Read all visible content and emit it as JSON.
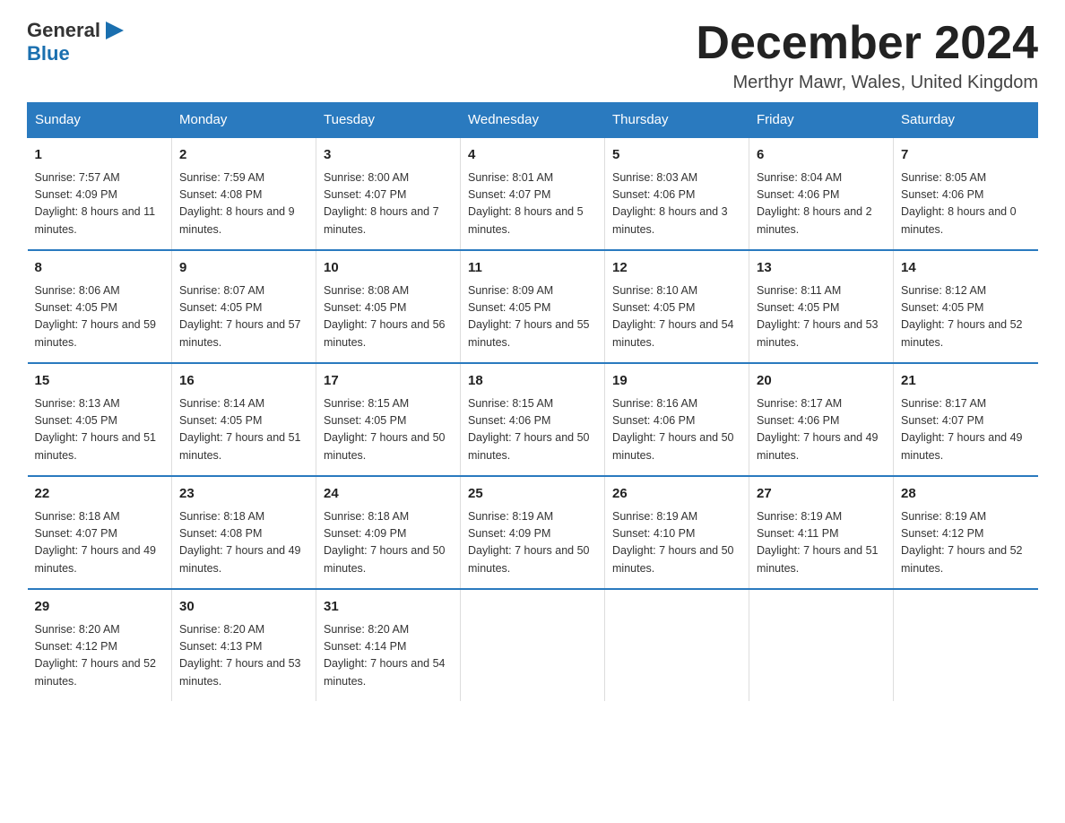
{
  "header": {
    "logo_text_black": "General",
    "logo_text_blue": "Blue",
    "month_title": "December 2024",
    "location": "Merthyr Mawr, Wales, United Kingdom"
  },
  "days_of_week": [
    "Sunday",
    "Monday",
    "Tuesday",
    "Wednesday",
    "Thursday",
    "Friday",
    "Saturday"
  ],
  "weeks": [
    [
      {
        "day": "1",
        "sunrise": "7:57 AM",
        "sunset": "4:09 PM",
        "daylight": "8 hours and 11 minutes."
      },
      {
        "day": "2",
        "sunrise": "7:59 AM",
        "sunset": "4:08 PM",
        "daylight": "8 hours and 9 minutes."
      },
      {
        "day": "3",
        "sunrise": "8:00 AM",
        "sunset": "4:07 PM",
        "daylight": "8 hours and 7 minutes."
      },
      {
        "day": "4",
        "sunrise": "8:01 AM",
        "sunset": "4:07 PM",
        "daylight": "8 hours and 5 minutes."
      },
      {
        "day": "5",
        "sunrise": "8:03 AM",
        "sunset": "4:06 PM",
        "daylight": "8 hours and 3 minutes."
      },
      {
        "day": "6",
        "sunrise": "8:04 AM",
        "sunset": "4:06 PM",
        "daylight": "8 hours and 2 minutes."
      },
      {
        "day": "7",
        "sunrise": "8:05 AM",
        "sunset": "4:06 PM",
        "daylight": "8 hours and 0 minutes."
      }
    ],
    [
      {
        "day": "8",
        "sunrise": "8:06 AM",
        "sunset": "4:05 PM",
        "daylight": "7 hours and 59 minutes."
      },
      {
        "day": "9",
        "sunrise": "8:07 AM",
        "sunset": "4:05 PM",
        "daylight": "7 hours and 57 minutes."
      },
      {
        "day": "10",
        "sunrise": "8:08 AM",
        "sunset": "4:05 PM",
        "daylight": "7 hours and 56 minutes."
      },
      {
        "day": "11",
        "sunrise": "8:09 AM",
        "sunset": "4:05 PM",
        "daylight": "7 hours and 55 minutes."
      },
      {
        "day": "12",
        "sunrise": "8:10 AM",
        "sunset": "4:05 PM",
        "daylight": "7 hours and 54 minutes."
      },
      {
        "day": "13",
        "sunrise": "8:11 AM",
        "sunset": "4:05 PM",
        "daylight": "7 hours and 53 minutes."
      },
      {
        "day": "14",
        "sunrise": "8:12 AM",
        "sunset": "4:05 PM",
        "daylight": "7 hours and 52 minutes."
      }
    ],
    [
      {
        "day": "15",
        "sunrise": "8:13 AM",
        "sunset": "4:05 PM",
        "daylight": "7 hours and 51 minutes."
      },
      {
        "day": "16",
        "sunrise": "8:14 AM",
        "sunset": "4:05 PM",
        "daylight": "7 hours and 51 minutes."
      },
      {
        "day": "17",
        "sunrise": "8:15 AM",
        "sunset": "4:05 PM",
        "daylight": "7 hours and 50 minutes."
      },
      {
        "day": "18",
        "sunrise": "8:15 AM",
        "sunset": "4:06 PM",
        "daylight": "7 hours and 50 minutes."
      },
      {
        "day": "19",
        "sunrise": "8:16 AM",
        "sunset": "4:06 PM",
        "daylight": "7 hours and 50 minutes."
      },
      {
        "day": "20",
        "sunrise": "8:17 AM",
        "sunset": "4:06 PM",
        "daylight": "7 hours and 49 minutes."
      },
      {
        "day": "21",
        "sunrise": "8:17 AM",
        "sunset": "4:07 PM",
        "daylight": "7 hours and 49 minutes."
      }
    ],
    [
      {
        "day": "22",
        "sunrise": "8:18 AM",
        "sunset": "4:07 PM",
        "daylight": "7 hours and 49 minutes."
      },
      {
        "day": "23",
        "sunrise": "8:18 AM",
        "sunset": "4:08 PM",
        "daylight": "7 hours and 49 minutes."
      },
      {
        "day": "24",
        "sunrise": "8:18 AM",
        "sunset": "4:09 PM",
        "daylight": "7 hours and 50 minutes."
      },
      {
        "day": "25",
        "sunrise": "8:19 AM",
        "sunset": "4:09 PM",
        "daylight": "7 hours and 50 minutes."
      },
      {
        "day": "26",
        "sunrise": "8:19 AM",
        "sunset": "4:10 PM",
        "daylight": "7 hours and 50 minutes."
      },
      {
        "day": "27",
        "sunrise": "8:19 AM",
        "sunset": "4:11 PM",
        "daylight": "7 hours and 51 minutes."
      },
      {
        "day": "28",
        "sunrise": "8:19 AM",
        "sunset": "4:12 PM",
        "daylight": "7 hours and 52 minutes."
      }
    ],
    [
      {
        "day": "29",
        "sunrise": "8:20 AM",
        "sunset": "4:12 PM",
        "daylight": "7 hours and 52 minutes."
      },
      {
        "day": "30",
        "sunrise": "8:20 AM",
        "sunset": "4:13 PM",
        "daylight": "7 hours and 53 minutes."
      },
      {
        "day": "31",
        "sunrise": "8:20 AM",
        "sunset": "4:14 PM",
        "daylight": "7 hours and 54 minutes."
      },
      null,
      null,
      null,
      null
    ]
  ],
  "labels": {
    "sunrise": "Sunrise: ",
    "sunset": "Sunset: ",
    "daylight": "Daylight: "
  }
}
